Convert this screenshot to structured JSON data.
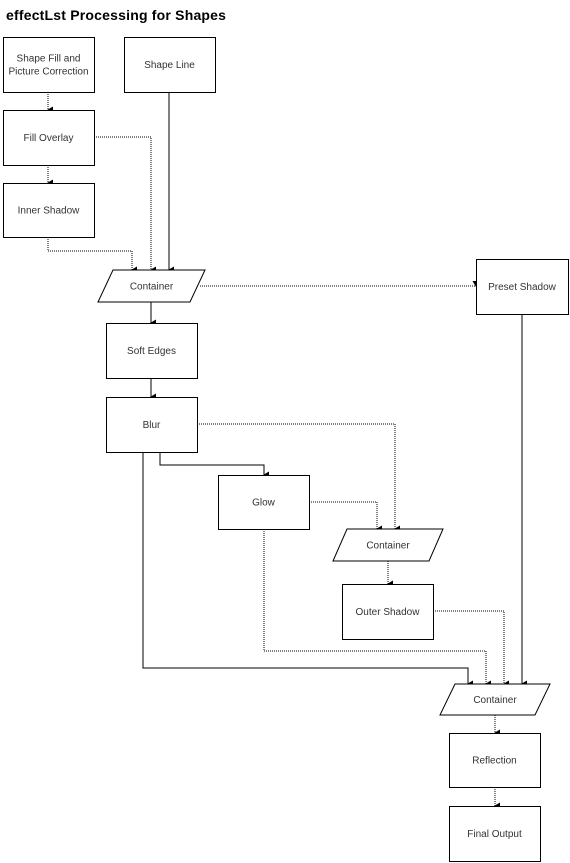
{
  "title": "effectLst Processing for Shapes",
  "nodes": [
    {
      "id": "shape-fill",
      "kind": "process",
      "lines": [
        "Shape Fill and",
        "Picture Correction"
      ]
    },
    {
      "id": "shape-line",
      "kind": "process",
      "lines": [
        "Shape Line"
      ]
    },
    {
      "id": "fill-overlay",
      "kind": "process",
      "lines": [
        "Fill Overlay"
      ]
    },
    {
      "id": "inner-shadow",
      "kind": "process",
      "lines": [
        "Inner Shadow"
      ]
    },
    {
      "id": "container-1",
      "kind": "data",
      "lines": [
        "Container"
      ]
    },
    {
      "id": "preset-shadow",
      "kind": "process",
      "lines": [
        "Preset Shadow"
      ]
    },
    {
      "id": "soft-edges",
      "kind": "process",
      "lines": [
        "Soft Edges"
      ]
    },
    {
      "id": "blur",
      "kind": "process",
      "lines": [
        "Blur"
      ]
    },
    {
      "id": "glow",
      "kind": "process",
      "lines": [
        "Glow"
      ]
    },
    {
      "id": "container-2",
      "kind": "data",
      "lines": [
        "Container"
      ]
    },
    {
      "id": "outer-shadow",
      "kind": "process",
      "lines": [
        "Outer Shadow"
      ]
    },
    {
      "id": "container-3",
      "kind": "data",
      "lines": [
        "Container"
      ]
    },
    {
      "id": "reflection",
      "kind": "process",
      "lines": [
        "Reflection"
      ]
    },
    {
      "id": "final-output",
      "kind": "process",
      "lines": [
        "Final Output"
      ]
    }
  ],
  "edges": [
    {
      "from": "shape-fill",
      "to": "fill-overlay"
    },
    {
      "from": "fill-overlay",
      "to": "inner-shadow"
    },
    {
      "from": "inner-shadow",
      "to": "container-1"
    },
    {
      "from": "fill-overlay",
      "to": "container-1"
    },
    {
      "from": "shape-line",
      "to": "container-1"
    },
    {
      "from": "container-1",
      "to": "preset-shadow"
    },
    {
      "from": "container-1",
      "to": "soft-edges"
    },
    {
      "from": "soft-edges",
      "to": "blur"
    },
    {
      "from": "blur",
      "to": "glow"
    },
    {
      "from": "blur",
      "to": "container-2"
    },
    {
      "from": "glow",
      "to": "container-2"
    },
    {
      "from": "container-2",
      "to": "outer-shadow"
    },
    {
      "from": "blur",
      "to": "container-3"
    },
    {
      "from": "glow",
      "to": "container-3"
    },
    {
      "from": "outer-shadow",
      "to": "container-3"
    },
    {
      "from": "preset-shadow",
      "to": "container-3"
    },
    {
      "from": "container-3",
      "to": "reflection"
    },
    {
      "from": "reflection",
      "to": "final-output"
    }
  ]
}
